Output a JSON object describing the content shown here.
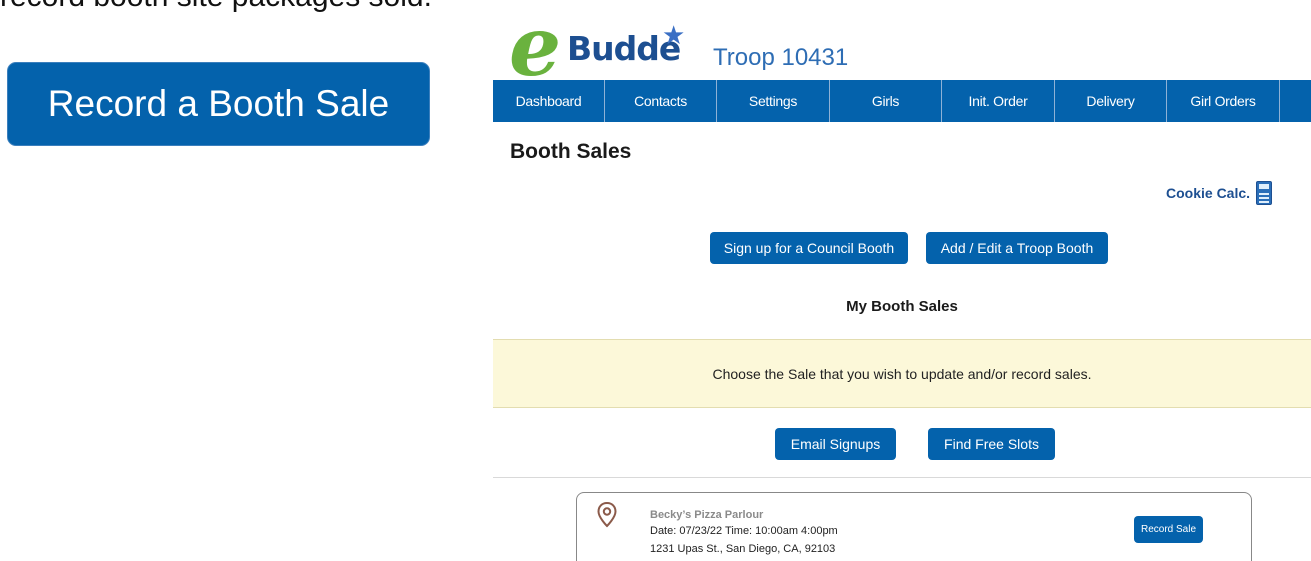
{
  "caption": "record booth site packages sold.",
  "callout_button": "Record a Booth Sale",
  "header": {
    "logo_text": "Budde",
    "troop": "Troop 10431"
  },
  "nav": [
    "Dashboard",
    "Contacts",
    "Settings",
    "Girls",
    "Init. Order",
    "Delivery",
    "Girl Orders"
  ],
  "page_title": "Booth Sales",
  "cookie_calc": "Cookie Calc.",
  "buttons": {
    "council_booth": "Sign up for a Council Booth",
    "troop_booth": "Add / Edit a Troop Booth",
    "email_signups": "Email Signups",
    "find_free_slots": "Find Free Slots"
  },
  "my_booth_sales": "My Booth Sales",
  "notice": "Choose the Sale that you wish to update and/or record sales.",
  "booth": {
    "name": "Becky’s Pizza Parlour",
    "date": "Date: 07/23/22  Time: 10:00am 4:00pm",
    "address": "1231 Upas St., San Diego, CA, 92103",
    "record_label": "Record Sale"
  },
  "colors": {
    "primary": "#0462ac",
    "notice_bg": "#fcf8d9",
    "logo_green": "#6ab23e"
  }
}
